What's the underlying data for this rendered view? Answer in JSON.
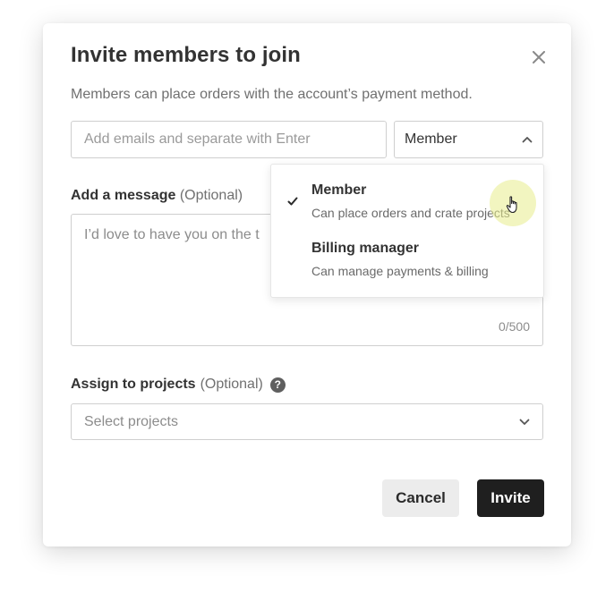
{
  "dialog": {
    "title": "Invite members to join",
    "subtitle": "Members can place orders with the account’s payment method.",
    "close_icon": "close-icon"
  },
  "email_input": {
    "value": "",
    "placeholder": "Add emails and separate with Enter"
  },
  "role_select": {
    "value": "Member",
    "icon": "chevron-up-icon"
  },
  "role_options": [
    {
      "name": "Member",
      "description": "Can place orders and crate projects",
      "selected": true
    },
    {
      "name": "Billing manager",
      "description": "Can manage payments & billing",
      "selected": false
    }
  ],
  "message": {
    "label": "Add a message",
    "optional": "(Optional)",
    "value": "",
    "placeholder": "I’d love to have you on the t",
    "counter": "0/500"
  },
  "projects": {
    "label": "Assign to projects",
    "optional": "(Optional)",
    "help_icon": "help-icon",
    "placeholder": "Select projects",
    "icon": "chevron-down-icon"
  },
  "buttons": {
    "cancel": "Cancel",
    "invite": "Invite"
  },
  "colors": {
    "primary_button": "#1f1f1f",
    "secondary_button": "#ececec",
    "border": "#cfcfcf",
    "cursor_highlight": "#e8ec8c"
  }
}
